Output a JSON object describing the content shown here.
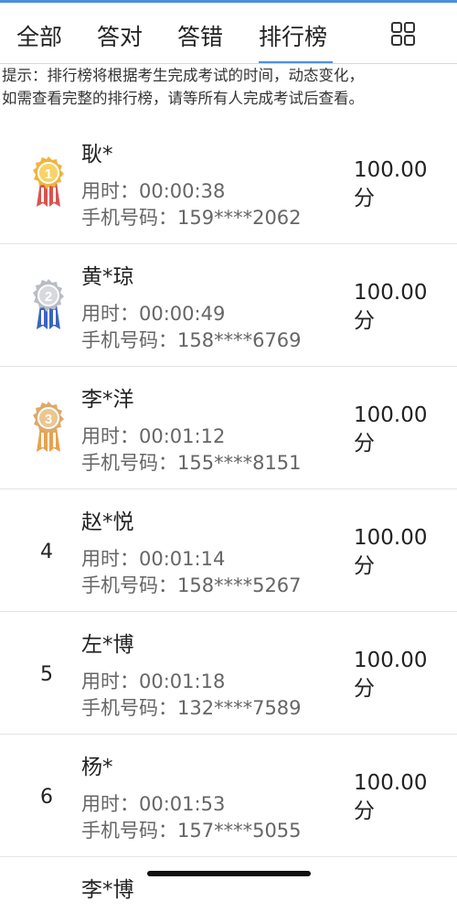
{
  "tabs": [
    {
      "label": "全部"
    },
    {
      "label": "答对"
    },
    {
      "label": "答错"
    },
    {
      "label": "排行榜"
    }
  ],
  "tip": {
    "line1": "提示：排行榜将根据考生完成考试的时间，动态变化，",
    "line2": "如需查看完整的排行榜，请等所有人完成考试后查看。"
  },
  "ranking": [
    {
      "rank": "1",
      "medal": "gold",
      "name": "耿*",
      "time": "用时：00:00:38",
      "phone": "手机号码：159****2062",
      "score_value": "100.00",
      "score_unit": "分"
    },
    {
      "rank": "2",
      "medal": "silver",
      "name": "黄*琼",
      "time": "用时：00:00:49",
      "phone": "手机号码：158****6769",
      "score_value": "100.00",
      "score_unit": "分"
    },
    {
      "rank": "3",
      "medal": "bronze",
      "name": "李*洋",
      "time": "用时：00:01:12",
      "phone": "手机号码：155****8151",
      "score_value": "100.00",
      "score_unit": "分"
    },
    {
      "rank": "4",
      "name": "赵*悦",
      "time": "用时：00:01:14",
      "phone": "手机号码：158****5267",
      "score_value": "100.00",
      "score_unit": "分"
    },
    {
      "rank": "5",
      "name": "左*博",
      "time": "用时：00:01:18",
      "phone": "手机号码：132****7589",
      "score_value": "100.00",
      "score_unit": "分"
    },
    {
      "rank": "6",
      "name": "杨*",
      "time": "用时：00:01:53",
      "phone": "手机号码：157****5055",
      "score_value": "100.00",
      "score_unit": "分"
    },
    {
      "name": "李*博"
    }
  ],
  "icons": {
    "medal_1": "gold-medal-icon",
    "medal_2": "silver-medal-icon",
    "medal_3": "bronze-medal-icon",
    "grid": "grid-icon"
  },
  "colors": {
    "accent": "#4a90e2",
    "gold": "#e9b93a",
    "silver": "#b9bcc2",
    "bronze": "#dcaa6a"
  }
}
